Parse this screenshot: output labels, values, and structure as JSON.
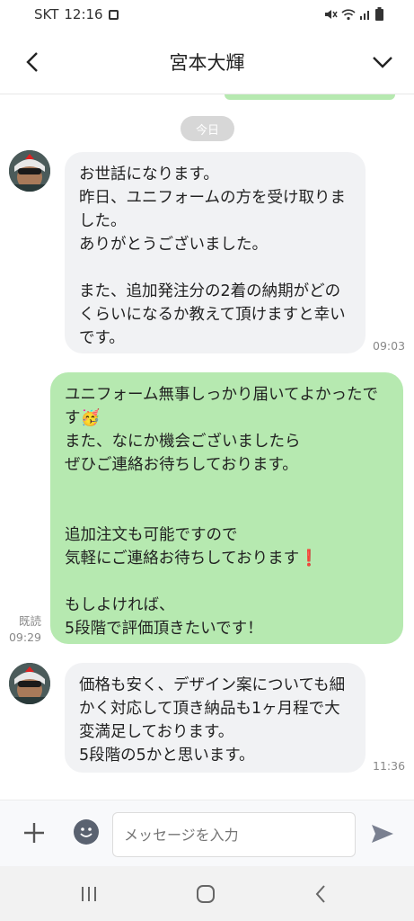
{
  "status_bar": {
    "carrier": "SKT",
    "time": "12:16"
  },
  "header": {
    "contact_name": "宮本大輝"
  },
  "date_divider": "今日",
  "messages": [
    {
      "direction": "incoming",
      "text": "お世話になります。\n昨日、ユニフォームの方を受け取りました。\nありがとうございました。\n\nまた、追加発注分の2着の納期がどのくらいになるか教えて頂けますと幸いです。",
      "time": "09:03"
    },
    {
      "direction": "outgoing",
      "text_part1": "ユニフォーム無事しっかり届いてよかったです",
      "party_emoji": "🥳",
      "text_part2": "\nまた、なにか機会ございましたら\nぜひご連絡お待ちしております。\n\n\n追加注文も可能ですので\n気軽にご連絡お待ちしております",
      "exclamation_emoji": "❗",
      "text_part3": "\n\nもしよければ、\n5段階で評価頂きたいです！",
      "read_label": "既読",
      "time": "09:29"
    },
    {
      "direction": "incoming",
      "text": "価格も安く、デザイン案についても細かく対応して頂き納品も1ヶ月程で大変満足しております。\n5段階の5かと思います。",
      "time": "11:36"
    }
  ],
  "composer": {
    "placeholder": "メッセージを入力"
  },
  "colors": {
    "outgoing_bubble": "#b6e9b0",
    "incoming_bubble": "#f1f2f4",
    "date_pill": "#d7d7d7"
  },
  "icons": [
    "back-chevron-icon",
    "dropdown-chevron-icon",
    "plus-icon",
    "emoji-icon",
    "send-icon",
    "recent-apps-icon",
    "home-icon",
    "back-nav-icon"
  ]
}
